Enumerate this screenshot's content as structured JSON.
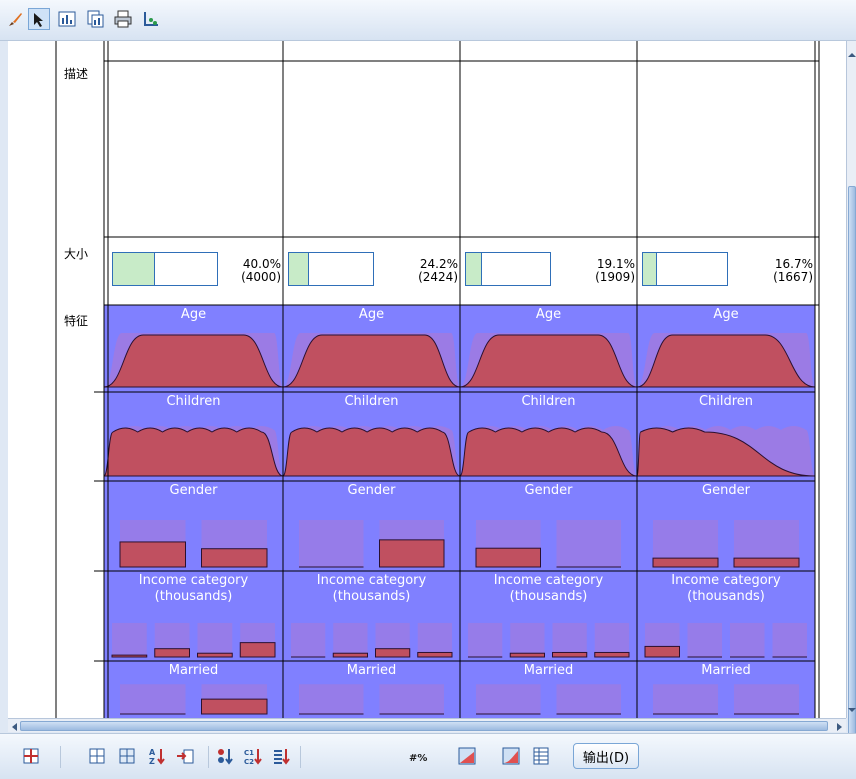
{
  "toolbar": {
    "icons": [
      "brush-icon",
      "pointer-icon",
      "chart-properties-icon",
      "copy-chart-icon",
      "print-icon",
      "axis-icon"
    ]
  },
  "table": {
    "row_labels": {
      "description": "描述",
      "size": "大小",
      "features": "特征"
    },
    "clusters": [
      {
        "size_fraction": 0.4,
        "size_percent": "40.0%",
        "size_count": "(4000)"
      },
      {
        "size_fraction": 0.242,
        "size_percent": "24.2%",
        "size_count": "(2424)"
      },
      {
        "size_fraction": 0.191,
        "size_percent": "19.1%",
        "size_count": "(1909)"
      },
      {
        "size_fraction": 0.167,
        "size_percent": "16.7%",
        "size_count": "(1667)"
      }
    ],
    "features": [
      {
        "title": "Age",
        "kind": "density"
      },
      {
        "title": "Children",
        "kind": "density"
      },
      {
        "title": "Gender",
        "kind": "bars"
      },
      {
        "title": "Income category (thousands)",
        "title_line1": "Income category",
        "title_line2": "(thousands)",
        "kind": "bars"
      },
      {
        "title": "Married",
        "kind": "bars"
      }
    ],
    "feature_values": {
      "Gender": [
        [
          0.48,
          0.35
        ],
        [
          0.0,
          0.52
        ],
        [
          0.36,
          0.0
        ],
        [
          0.17,
          0.17
        ]
      ],
      "Income category (thousands)": [
        [
          0.05,
          0.22,
          0.1,
          0.38
        ],
        [
          0.0,
          0.1,
          0.22,
          0.12
        ],
        [
          0.0,
          0.1,
          0.12,
          0.12
        ],
        [
          0.28,
          0.0,
          0.0,
          0.0
        ]
      ],
      "Married": [
        [
          0.0,
          0.45
        ],
        [
          0.0,
          0.0
        ],
        [
          0.0,
          0.0
        ],
        [
          0.0,
          0.0
        ]
      ]
    },
    "colors": {
      "feature_bg": "#8080ff",
      "cluster_dist": "#c05060",
      "overall_dist": "#a07ae0",
      "size_fill": "#c8ebc8",
      "size_border": "#2f6fb8"
    }
  },
  "bottombar": {
    "icons": [
      "transpose-icon",
      "grid-icon",
      "grid-alt-icon",
      "sort-az-icon",
      "insert-icon",
      "sort-clusters-icon",
      "sort-c1c2-icon",
      "sort-list-icon",
      "percent-icon",
      "chart-area-icon",
      "chart-line-icon",
      "table-view-icon"
    ],
    "output_label": "输出(D)"
  }
}
